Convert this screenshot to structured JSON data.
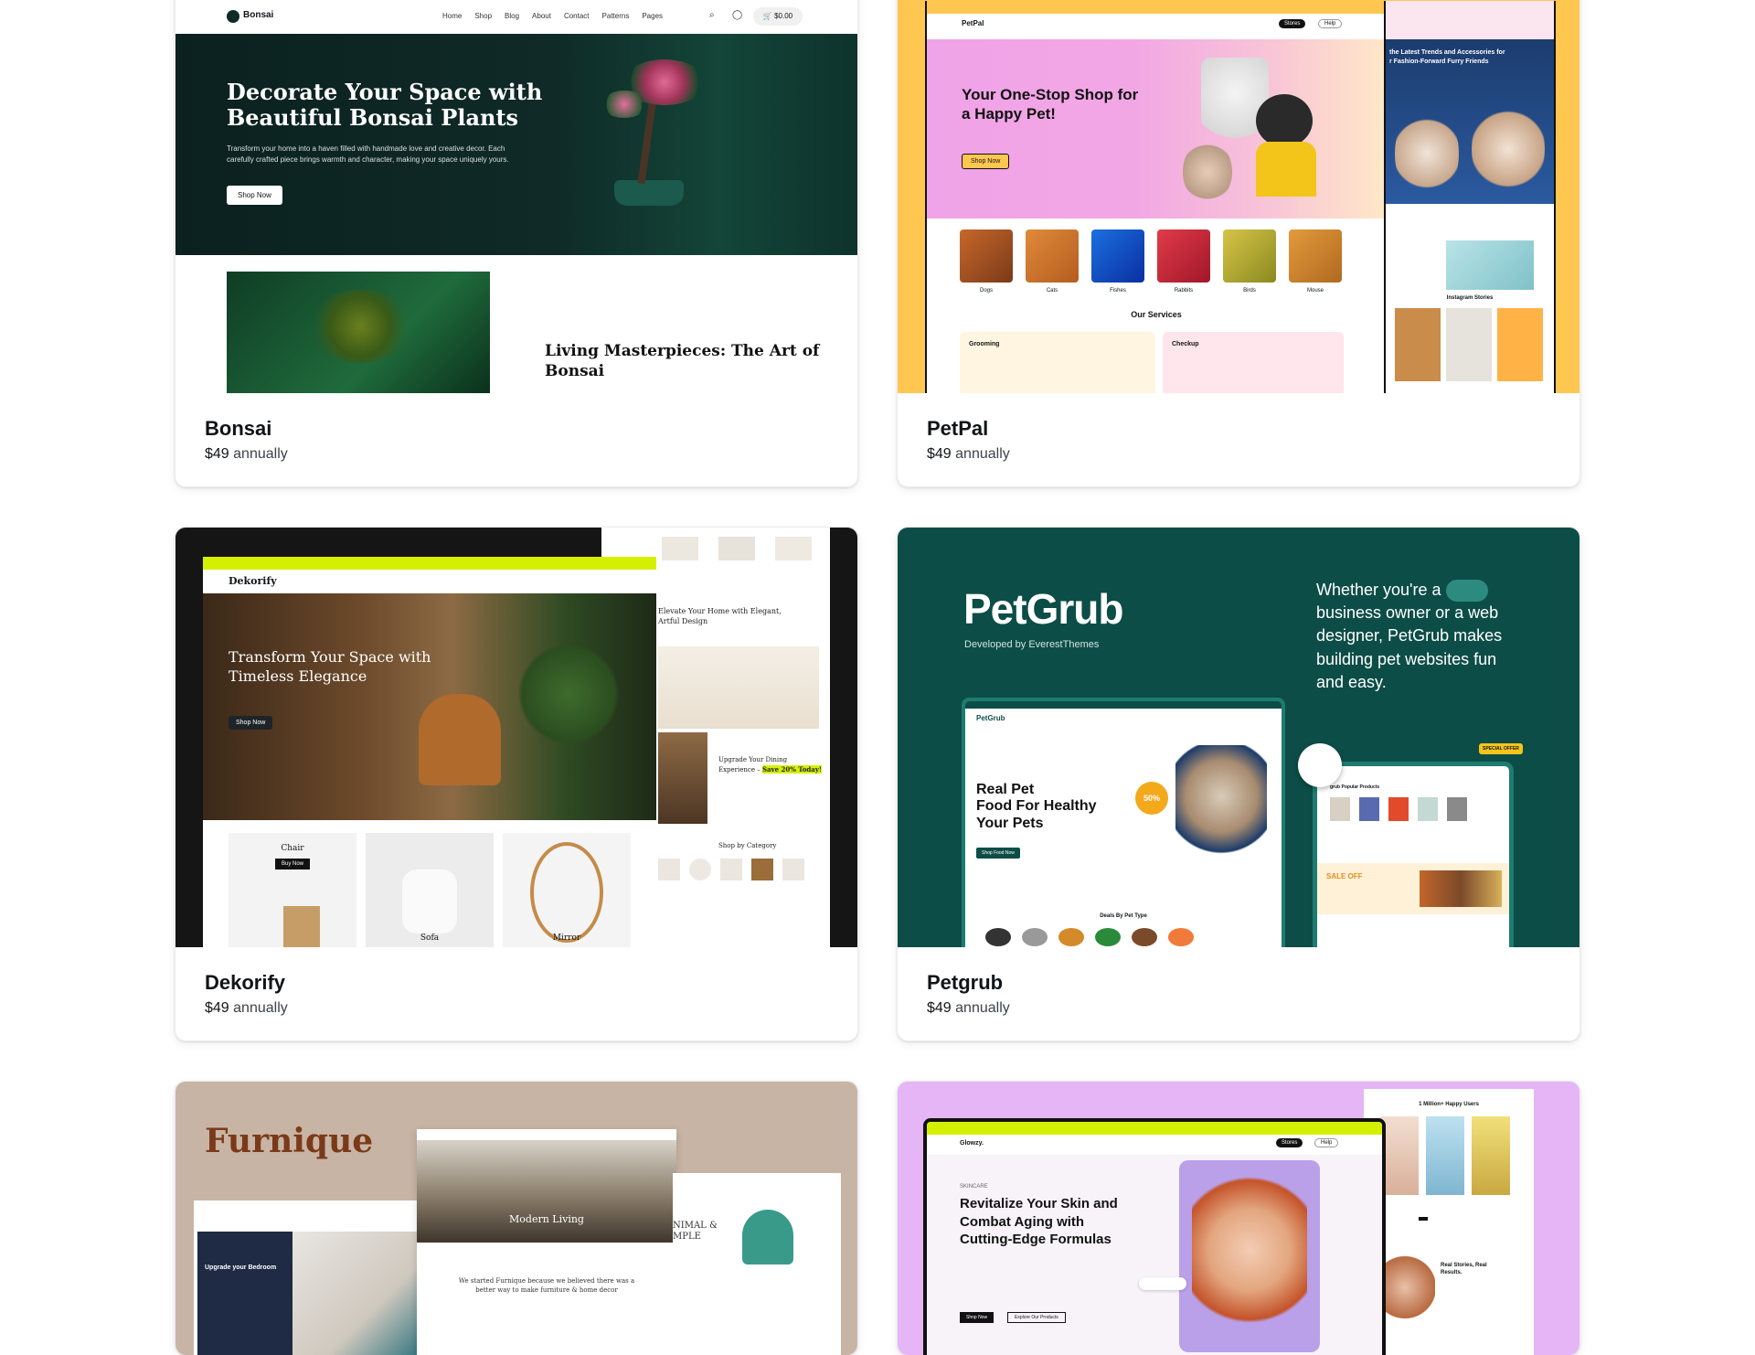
{
  "themes": [
    {
      "id": "bonsai",
      "name": "Bonsai",
      "price": "$49",
      "period": "annually",
      "preview": {
        "logo": "Bonsai",
        "nav": [
          "Home",
          "Shop",
          "Blog",
          "About",
          "Contact",
          "Patterns",
          "Pages"
        ],
        "cart": "$0.00",
        "hero_title_1": "Decorate Your Space with",
        "hero_title_2": "Beautiful Bonsai Plants",
        "hero_text_1": "Transform your home into a haven filled with handmade love and creative decor. Each",
        "hero_text_2": "carefully crafted piece brings warmth and character, making your space uniquely yours.",
        "hero_cta": "Shop Now",
        "section_title_1": "Living Masterpieces: The Art of",
        "section_title_2": "Bonsai"
      }
    },
    {
      "id": "petpal",
      "name": "PetPal",
      "price": "$49",
      "period": "annually",
      "preview": {
        "logo": "PetPal",
        "hero_title_1": "Your One-Stop Shop for",
        "hero_title_2": "a Happy Pet!",
        "hero_cta": "Shop Now",
        "categories": [
          "Dogs",
          "Cats",
          "Fishes",
          "Rabbits",
          "Birds",
          "Mouse"
        ],
        "services_title": "Our Services",
        "service_1": "Grooming",
        "service_2": "Checkup",
        "side_title_1": "the Latest Trends and Accessories for",
        "side_title_2": "r Fashion-Forward Furry Friends",
        "insta_title": "Instagram Stories",
        "stores_btn": "Stores",
        "help_btn": "Help"
      }
    },
    {
      "id": "dekorify",
      "name": "Dekorify",
      "price": "$49",
      "period": "annually",
      "preview": {
        "logo": "Dekorify",
        "hero_title_1": "Transform Your Space with",
        "hero_title_2": "Timeless Elegance",
        "hero_cta": "Shop Now",
        "products": [
          "Chair",
          "Sofa",
          "Mirror"
        ],
        "buy_now": "Buy Now",
        "side_title_1": "Elevate Your Home with Elegant,",
        "side_title_2": "Artful Design",
        "dining_1": "Upgrade Your Dining",
        "dining_2": "Experience –",
        "save_badge": "Save 20% Today!",
        "shop_by": "Shop by Category"
      }
    },
    {
      "id": "petgrub",
      "name": "Petgrub",
      "price": "$49",
      "period": "annually",
      "preview": {
        "brand": "PetGrub",
        "developer": "Developed by EverestThemes",
        "tagline_1": "Whether you're a",
        "tagline_2": "business owner or a web",
        "tagline_3": "designer, PetGrub makes",
        "tagline_4": "building pet websites fun",
        "tagline_5": "and easy.",
        "screen_logo": "PetGrub",
        "screen_title_1": "Real Pet",
        "screen_title_2": "Food For Healthy",
        "screen_title_3": "Your",
        "screen_title_4": "Pets",
        "screen_cta": "Shop Food Now",
        "discount": "50%",
        "deals_title": "Deals By Pet Type",
        "popular": "grub Popular Products",
        "sale": "SALE OFF",
        "special": "SPECIAL OFFER"
      }
    },
    {
      "id": "furnique",
      "name": "Furnique",
      "preview": {
        "brand": "Furnique",
        "banner": "Upgrade your Bedroom",
        "center_title": "Modern Living",
        "story": "We started Furnique because we believed there was a",
        "story_2": "better way to make furniture & home decor",
        "side_text_1": "NIMAL &",
        "side_text_2": "MPLE"
      }
    },
    {
      "id": "glowzy",
      "name": "Glowzy",
      "preview": {
        "logo": "Glowzy.",
        "eyebrow": "SKINCARE",
        "hero_title_1": "Revitalize Your Skin and",
        "hero_title_2": "Combat Aging with",
        "hero_title_3": "Cutting-Edge Formulas",
        "users": "1 Million+ Happy Users",
        "stories_1": "Real Stories, Real",
        "stories_2": "Results.",
        "shop_now": "Shop Now",
        "explore": "Explore Our Products",
        "stores_btn": "Stores",
        "help_btn": "Help"
      }
    }
  ],
  "colors": {
    "bonsai_dark": "#0f2a27",
    "petpal_yellow": "#ffc750",
    "petgrub_teal": "#0d4d47",
    "furnique_tan": "#c8b4a4",
    "glowzy_violet": "#e5b5f5",
    "lime": "#d4f000"
  }
}
